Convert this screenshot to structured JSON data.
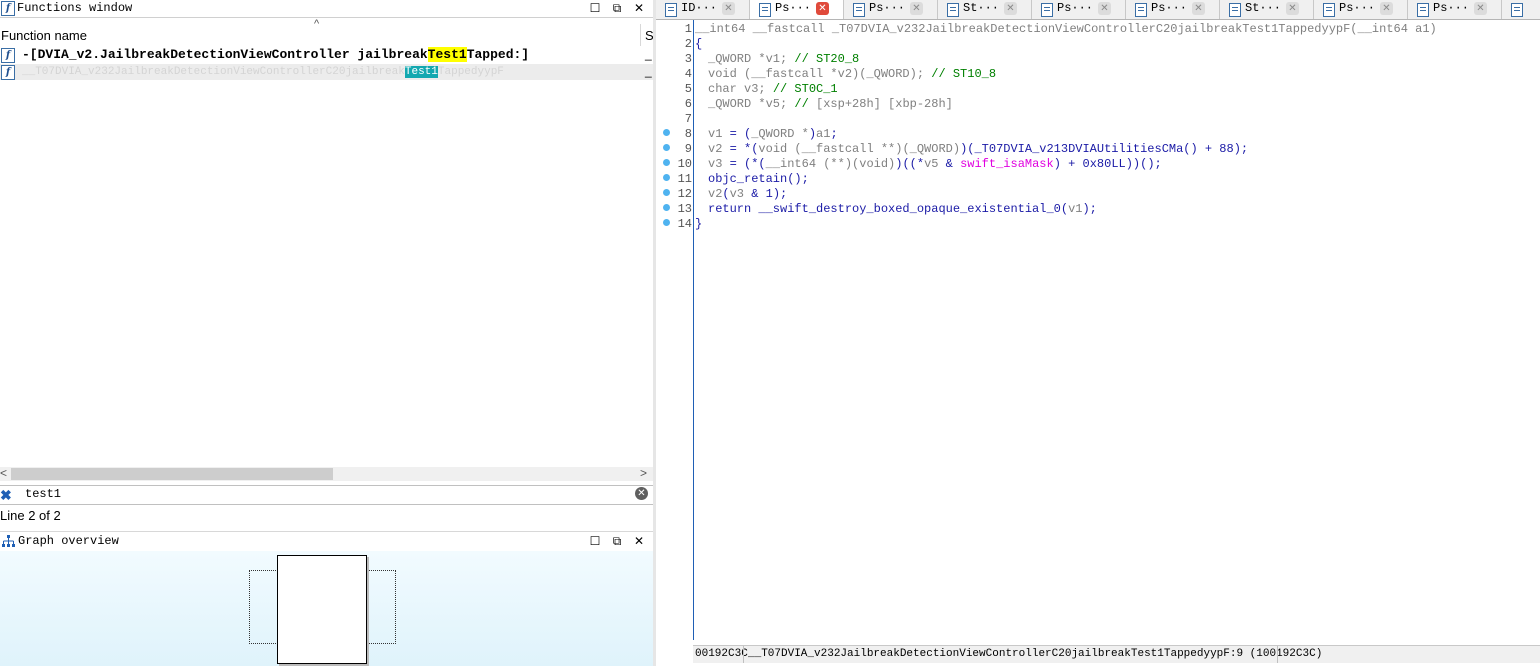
{
  "functions_window": {
    "title": "Functions window",
    "column_header": "Function name",
    "column_header_right": "S",
    "rows": [
      {
        "pre": "-[DVIA_v2.JailbreakDetectionViewController jailbreak",
        "match": "Test1",
        "post": "Tapped:]",
        "dash": "_"
      },
      {
        "pre": "__T07DVIA_v232JailbreakDetectionViewControllerC20jailbreak",
        "match": "Test1",
        "post": "TappedyypF",
        "dash": "_"
      }
    ],
    "search_value": "test1",
    "status": "Line 2 of 2"
  },
  "graph_overview": {
    "title": "Graph overview"
  },
  "tabs": [
    {
      "label": "ID···",
      "active": false
    },
    {
      "label": "Ps···",
      "active": true
    },
    {
      "label": "Ps···",
      "active": false
    },
    {
      "label": "St···",
      "active": false
    },
    {
      "label": "Ps···",
      "active": false
    },
    {
      "label": "Ps···",
      "active": false
    },
    {
      "label": "St···",
      "active": false
    },
    {
      "label": "Ps···",
      "active": false
    },
    {
      "label": "Ps···",
      "active": false
    }
  ],
  "code": {
    "line_numbers": [
      "1",
      "2",
      "3",
      "4",
      "5",
      "6",
      "7",
      "8",
      "9",
      "10",
      "11",
      "12",
      "13",
      "14"
    ],
    "line1": "__int64 __fastcall _T07DVIA_v232JailbreakDetectionViewControllerC20jailbreakTest1TappedyypF(__int64 a1)",
    "line2": "{",
    "line3a": "_QWORD *v1;",
    "line3b": "// ST20_8",
    "line4a": "void (__fastcall *v2)(_QWORD);",
    "line4b": "// ST10_8",
    "line5a": "char v3;",
    "line5b": "// ST0C_1",
    "line6a": "_QWORD *v5;",
    "line6b": "//",
    "line6c": "[xsp+28h] [xbp-28h]",
    "line8a": "v1",
    "line8b": " = (",
    "line8c": "_QWORD *",
    "line8d": ")",
    "line8e": "a1",
    "line8f": ";",
    "line9a": "v2",
    "line9b": " = *(",
    "line9c": "void (__fastcall **)(_QWORD)",
    "line9d": ")(_T07DVIA_v213DVIAUtilitiesCMa() + 88);",
    "line10a": "v3",
    "line10b": " = (*(",
    "line10c": "__int64 (**)(void)",
    "line10d": ")((*",
    "line10e": "v5",
    "line10f": " & ",
    "line10g": "swift_isaMask",
    "line10h": ") + 0x80LL))();",
    "line11": "objc_retain();",
    "line12a": "v2",
    "line12b": "(",
    "line12c": "v3",
    "line12d": " & 1);",
    "line13a": "return __swift_destroy_boxed_opaque_existential_0(",
    "line13b": "v1",
    "line13c": ");",
    "line14": "}"
  },
  "status_bar": {
    "address": "00192C3C",
    "location": "__T07DVIA_v232JailbreakDetectionViewControllerC20jailbreakTest1TappedyypF:9 (100192C3C)"
  },
  "colors": {
    "highlight_yellow": "#ffff00",
    "highlight_cyan": "#13a8b0",
    "gutter_blue": "#1f5fb5",
    "breakpoint_dot": "#4fb3f0"
  }
}
